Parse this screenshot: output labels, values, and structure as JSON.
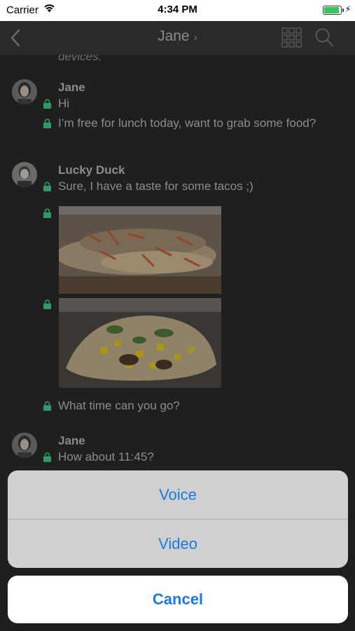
{
  "status_bar": {
    "carrier": "Carrier",
    "time": "4:34 PM"
  },
  "nav": {
    "title": "Jane",
    "chevron": "›"
  },
  "chat": {
    "faded_text": "devices.",
    "messages": [
      {
        "sender": "Jane",
        "lines": [
          "Hi",
          "I’m free for lunch today, want to grab some food?"
        ]
      },
      {
        "sender": "Lucky Duck",
        "lines": [
          "Sure, I have a taste for some tacos ;)",
          "What time can you go?"
        ]
      },
      {
        "sender": "Jane",
        "lines": [
          "How about 11:45?"
        ]
      }
    ]
  },
  "action_sheet": {
    "voice": "Voice",
    "video": "Video",
    "cancel": "Cancel"
  },
  "colors": {
    "accent_green": "#2f9a66",
    "action_blue": "#1a7ae0",
    "background": "#1f1f1f"
  }
}
